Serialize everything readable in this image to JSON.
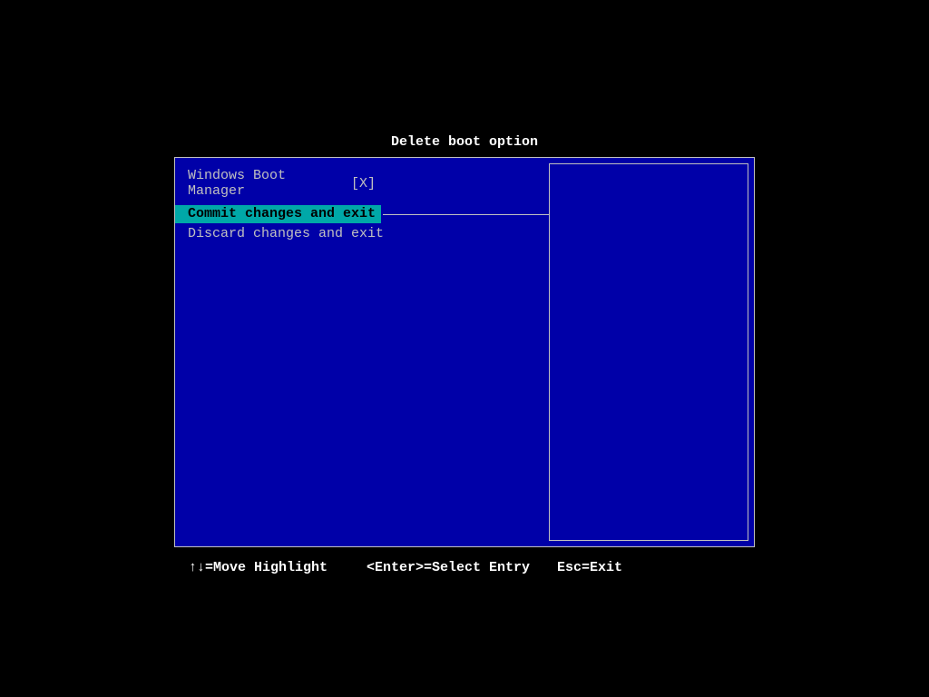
{
  "title": "Delete boot option",
  "entry": {
    "label": "Windows Boot Manager",
    "value": "[X]"
  },
  "menu": {
    "commit": "Commit changes and exit",
    "discard": "Discard changes and exit"
  },
  "footer": {
    "move": "↑↓=Move Highlight",
    "select": "<Enter>=Select Entry",
    "exit": "Esc=Exit"
  }
}
